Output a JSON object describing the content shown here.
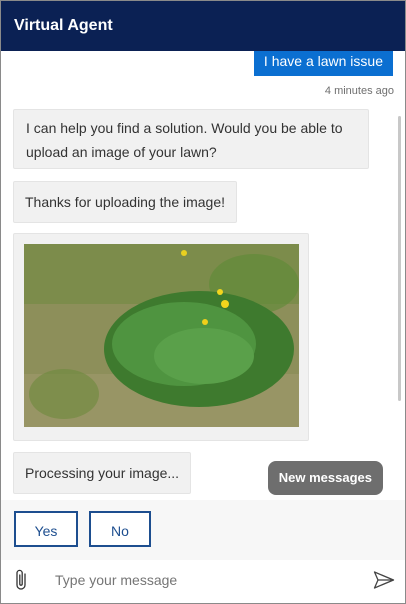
{
  "header": {
    "title": "Virtual Agent"
  },
  "messages": {
    "user_text": "I have a lawn issue",
    "timestamp": "4 minutes ago",
    "bot": [
      "I can help you find a solution. Would you be able to upload an image of your lawn?",
      "Thanks for uploading the image!",
      "Processing your image..."
    ]
  },
  "new_messages_label": "New messages",
  "quick_replies": [
    "Yes",
    "No"
  ],
  "compose": {
    "placeholder": "Type your message"
  },
  "icons": {
    "attach": "paperclip-icon",
    "send": "send-icon"
  },
  "colors": {
    "header_bg": "#0b2154",
    "user_bubble": "#0b6fd1",
    "button_border": "#1d4e8f"
  }
}
